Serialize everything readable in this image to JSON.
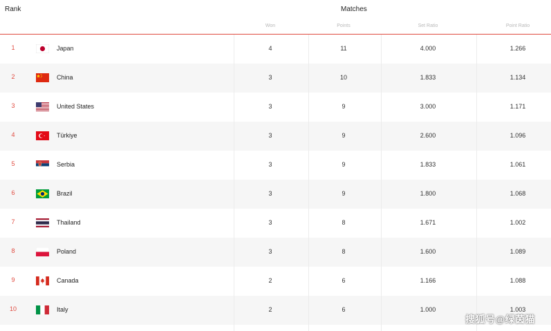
{
  "header": {
    "rank_title": "Rank",
    "matches_title": "Matches",
    "columns": [
      "Won",
      "Points",
      "Set Ratio",
      "Point Ratio"
    ]
  },
  "colors": {
    "accent": "#e04a3f",
    "alt_row": "#f6f6f6"
  },
  "rows": [
    {
      "rank": "1",
      "country": "Japan",
      "flag": "japan-flag-icon",
      "won": "4",
      "points": "11",
      "set_ratio": "4.000",
      "point_ratio": "1.266"
    },
    {
      "rank": "2",
      "country": "China",
      "flag": "china-flag-icon",
      "won": "3",
      "points": "10",
      "set_ratio": "1.833",
      "point_ratio": "1.134"
    },
    {
      "rank": "3",
      "country": "United States",
      "flag": "usa-flag-icon",
      "won": "3",
      "points": "9",
      "set_ratio": "3.000",
      "point_ratio": "1.171"
    },
    {
      "rank": "4",
      "country": "Türkiye",
      "flag": "turkey-flag-icon",
      "won": "3",
      "points": "9",
      "set_ratio": "2.600",
      "point_ratio": "1.096"
    },
    {
      "rank": "5",
      "country": "Serbia",
      "flag": "serbia-flag-icon",
      "won": "3",
      "points": "9",
      "set_ratio": "1.833",
      "point_ratio": "1.061"
    },
    {
      "rank": "6",
      "country": "Brazil",
      "flag": "brazil-flag-icon",
      "won": "3",
      "points": "9",
      "set_ratio": "1.800",
      "point_ratio": "1.068"
    },
    {
      "rank": "7",
      "country": "Thailand",
      "flag": "thailand-flag-icon",
      "won": "3",
      "points": "8",
      "set_ratio": "1.671",
      "point_ratio": "1.002"
    },
    {
      "rank": "8",
      "country": "Poland",
      "flag": "poland-flag-icon",
      "won": "3",
      "points": "8",
      "set_ratio": "1.600",
      "point_ratio": "1.089"
    },
    {
      "rank": "9",
      "country": "Canada",
      "flag": "canada-flag-icon",
      "won": "2",
      "points": "6",
      "set_ratio": "1.166",
      "point_ratio": "1.088"
    },
    {
      "rank": "10",
      "country": "Italy",
      "flag": "italy-flag-icon",
      "won": "2",
      "points": "6",
      "set_ratio": "1.000",
      "point_ratio": "1.003"
    }
  ],
  "watermark": "搜狐号@绿茵猫"
}
